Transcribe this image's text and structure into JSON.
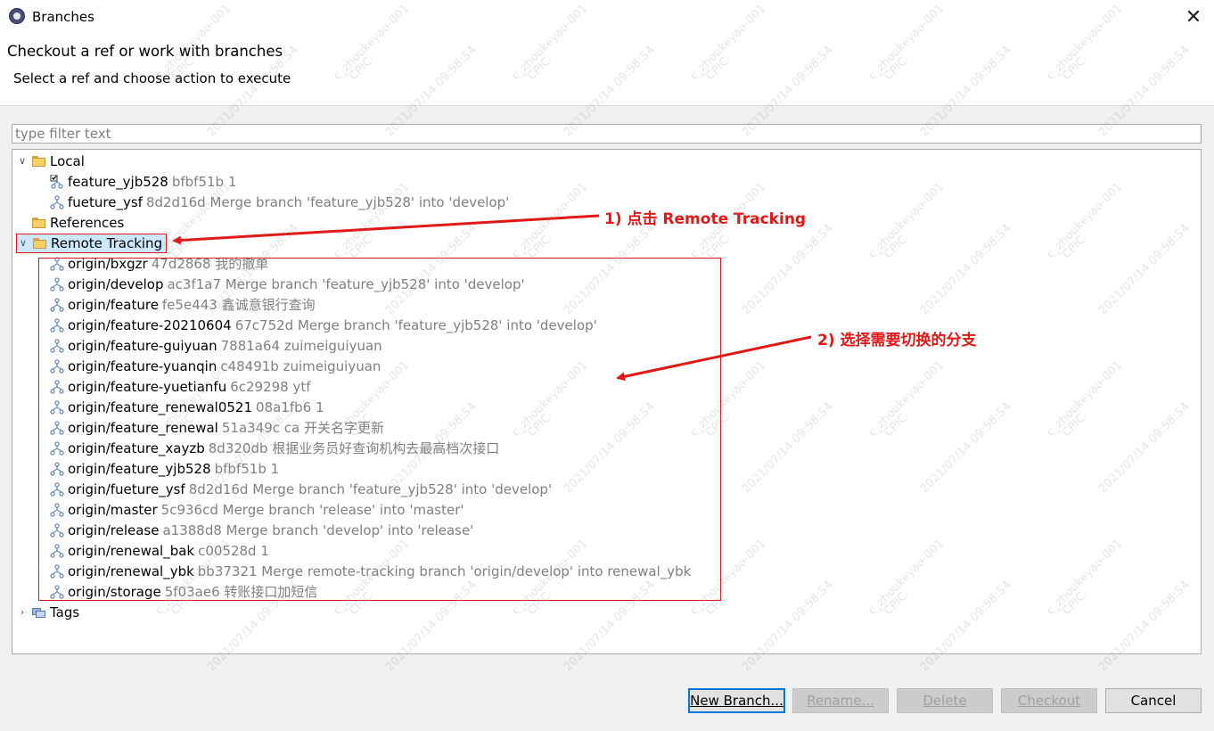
{
  "window": {
    "title": "Branches",
    "close_icon": "✕"
  },
  "header": {
    "title": "Checkout a ref or work with branches",
    "subtitle": "Select a ref and choose action to execute"
  },
  "filter": {
    "placeholder": "type filter text",
    "value": ""
  },
  "tree": {
    "local": {
      "label": "Local",
      "branches": [
        {
          "name": "feature_yjb528",
          "meta": "bfbf51b 1",
          "checked": true
        },
        {
          "name": "fueture_ysf",
          "meta": "8d2d16d Merge branch 'feature_yjb528' into 'develop'"
        }
      ]
    },
    "references": {
      "label": "References"
    },
    "remote_tracking": {
      "label": "Remote Tracking",
      "branches": [
        {
          "name": "origin/bxgzr",
          "meta": "47d2868 我的撤单"
        },
        {
          "name": "origin/develop",
          "meta": "ac3f1a7 Merge branch 'feature_yjb528' into 'develop'"
        },
        {
          "name": "origin/feature",
          "meta": "fe5e443 鑫诚意银行查询"
        },
        {
          "name": "origin/feature-20210604",
          "meta": "67c752d Merge branch 'feature_yjb528' into 'develop'"
        },
        {
          "name": "origin/feature-guiyuan",
          "meta": "7881a64 zuimeiguiyuan"
        },
        {
          "name": "origin/feature-yuanqin",
          "meta": "c48491b zuimeiguiyuan"
        },
        {
          "name": "origin/feature-yuetianfu",
          "meta": "6c29298 ytf"
        },
        {
          "name": "origin/feature_renewal0521",
          "meta": "08a1fb6 1"
        },
        {
          "name": "origin/feature_renewal",
          "meta": "51a349c ca   开关名字更新"
        },
        {
          "name": "origin/feature_xayzb",
          "meta": "8d320db 根据业务员好查询机构去最高档次接口"
        },
        {
          "name": "origin/feature_yjb528",
          "meta": "bfbf51b 1"
        },
        {
          "name": "origin/fueture_ysf",
          "meta": "8d2d16d Merge branch 'feature_yjb528' into 'develop'"
        },
        {
          "name": "origin/master",
          "meta": "5c936cd Merge branch 'release' into 'master'"
        },
        {
          "name": "origin/release",
          "meta": "a1388d8 Merge branch 'develop' into 'release'"
        },
        {
          "name": "origin/renewal_bak",
          "meta": "c00528d 1"
        },
        {
          "name": "origin/renewal_ybk",
          "meta": "bb37321 Merge remote-tracking branch 'origin/develop' into renewal_ybk"
        },
        {
          "name": "origin/storage",
          "meta": "5f03ae6 转账接口加短信"
        }
      ]
    },
    "tags": {
      "label": "Tags"
    }
  },
  "annotations": {
    "step1": "1) 点击 Remote Tracking",
    "step2": "2) 选择需要切换的分支"
  },
  "buttons": {
    "new_branch": "New Branch...",
    "rename": "Rename...",
    "delete": "Delete",
    "checkout": "Checkout",
    "cancel": "Cancel"
  },
  "watermark": {
    "user": "c_zhoukeyao-001",
    "org": "CPIC",
    "timestamp": "2021/07/14 09:58:54"
  },
  "colors": {
    "annotation_red": "#e01818",
    "selection_bg": "#cce8ff",
    "meta_gray": "#808080"
  }
}
